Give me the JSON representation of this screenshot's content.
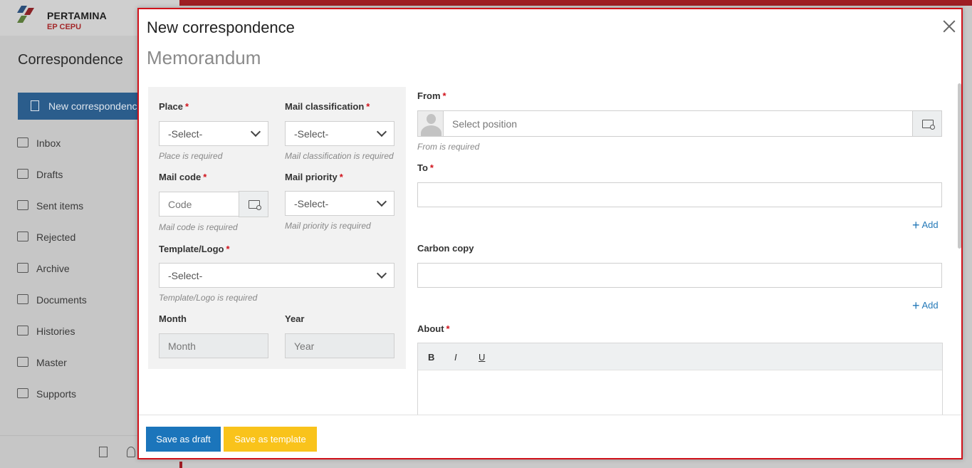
{
  "app": {
    "logo_name": "PERTAMINA",
    "logo_sub": "EP CEPU",
    "title": "Correspondence",
    "new_button": "New correspondence",
    "nav": [
      "Inbox",
      "Drafts",
      "Sent items",
      "Rejected",
      "Archive",
      "Documents",
      "Histories",
      "Master",
      "Supports"
    ]
  },
  "modal": {
    "title": "New correspondence",
    "subtitle": "Memorandum",
    "left": {
      "place": {
        "label": "Place",
        "value": "-Select-",
        "help": "Place is required"
      },
      "mail_classification": {
        "label": "Mail classification",
        "value": "-Select-",
        "help": "Mail classification is required"
      },
      "mail_code": {
        "label": "Mail code",
        "placeholder": "Code",
        "help": "Mail code is required"
      },
      "mail_priority": {
        "label": "Mail priority",
        "value": "-Select-",
        "help": "Mail priority is required"
      },
      "template_logo": {
        "label": "Template/Logo",
        "value": "-Select-",
        "help": "Template/Logo is required"
      },
      "month": {
        "label": "Month",
        "placeholder": "Month"
      },
      "year": {
        "label": "Year",
        "placeholder": "Year"
      }
    },
    "right": {
      "from": {
        "label": "From",
        "placeholder": "Select position",
        "help": "From is required"
      },
      "to": {
        "label": "To",
        "add": "Add"
      },
      "cc": {
        "label": "Carbon copy",
        "add": "Add"
      },
      "about": {
        "label": "About",
        "bold": "B",
        "italic": "I",
        "underline": "U"
      }
    },
    "required_mark": "*",
    "footer": {
      "save_draft": "Save as draft",
      "save_template": "Save as template"
    }
  },
  "colors": {
    "primary": "#1b75bb",
    "warning": "#f9c31b",
    "required": "#d0121b",
    "brand_red": "#9e1e24"
  }
}
